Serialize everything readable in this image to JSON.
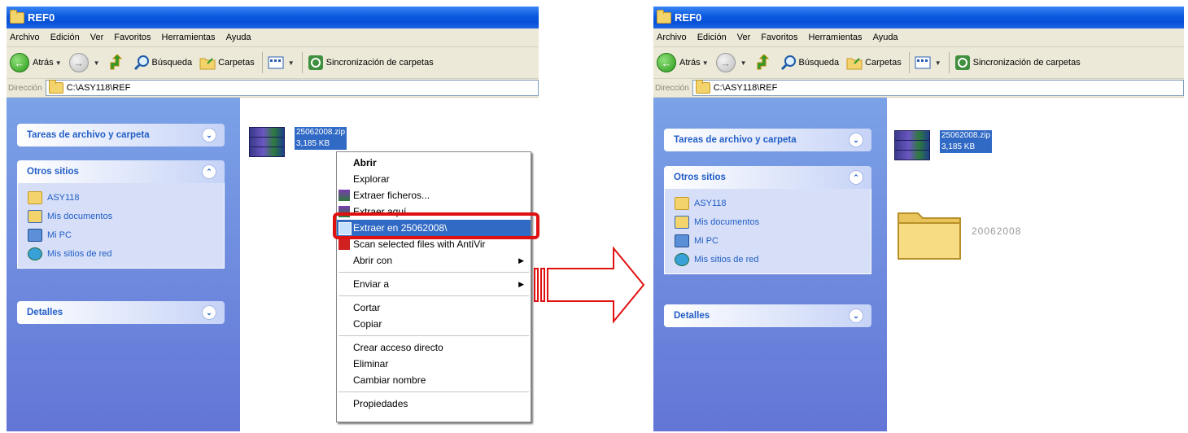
{
  "window": {
    "title": "REF0"
  },
  "menu": [
    "Archivo",
    "Edición",
    "Ver",
    "Favoritos",
    "Herramientas",
    "Ayuda"
  ],
  "toolbar": {
    "back": "Atrás",
    "search": "Búsqueda",
    "folders": "Carpetas",
    "sync": "Sincronización de carpetas"
  },
  "address": {
    "label": "Dirección",
    "path": "C:\\ASY118\\REF"
  },
  "tasks": {
    "file_tasks": "Tareas de archivo y carpeta",
    "other_places": "Otros sitios",
    "places": [
      "ASY118",
      "Mis documentos",
      "Mi PC",
      "Mis sitios de red"
    ],
    "details": "Detalles"
  },
  "file": {
    "name": "25062008.zip",
    "size": "3,185 KB"
  },
  "extracted_folder": {
    "name": "20062008"
  },
  "context_menu": {
    "open": "Abrir",
    "explore": "Explorar",
    "extract_files": "Extraer ficheros...",
    "extract_here": "Extraer aquí",
    "extract_to": "Extraer en 25062008\\",
    "scan": "Scan selected files with AntiVir",
    "open_with": "Abrir con",
    "send_to": "Enviar a",
    "cut": "Cortar",
    "copy": "Copiar",
    "shortcut": "Crear acceso directo",
    "delete": "Eliminar",
    "rename": "Cambiar nombre",
    "properties": "Propiedades"
  },
  "colors": {
    "highlight": "#e01010",
    "selection": "#316ac5",
    "taskpane": "#6375d6"
  },
  "icons": [
    "folder-icon",
    "back-icon",
    "forward-icon",
    "up-icon",
    "search-icon",
    "folders-icon",
    "views-icon",
    "sync-icon",
    "winrar-icon",
    "antivir-icon",
    "mypc-icon",
    "network-icon",
    "chevron-icon",
    "arrow-icon"
  ]
}
